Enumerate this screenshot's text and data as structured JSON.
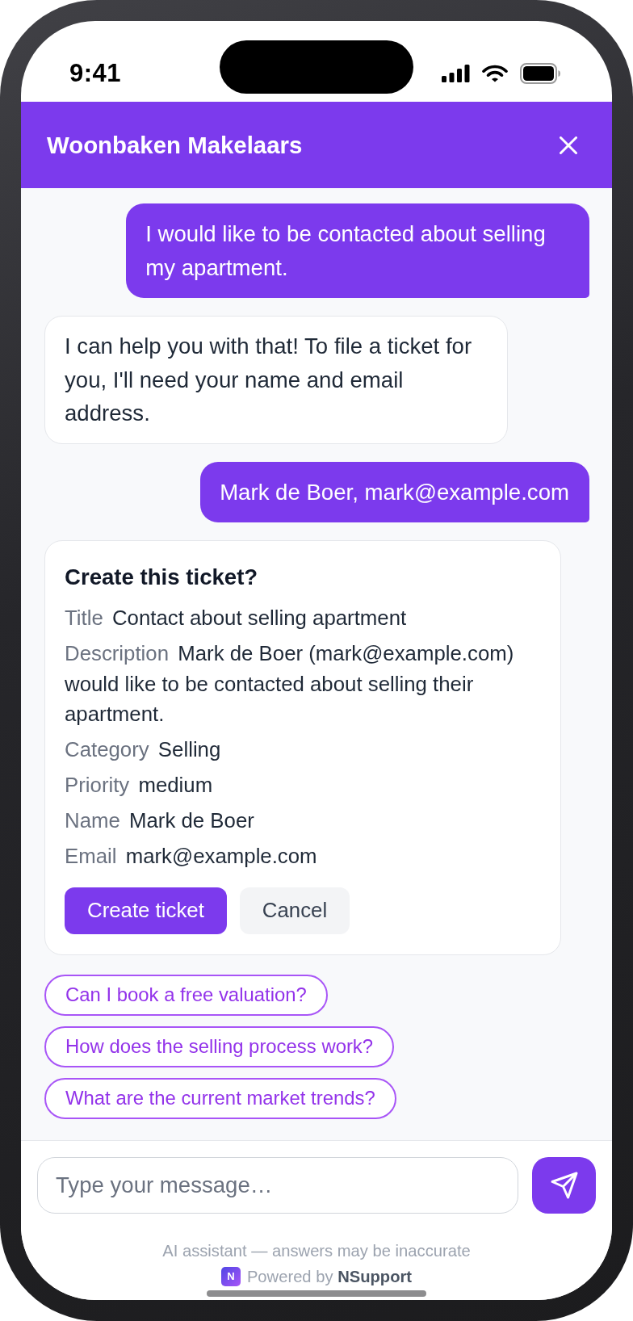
{
  "status_bar": {
    "time": "9:41"
  },
  "header": {
    "title": "Woonbaken Makelaars"
  },
  "messages": [
    {
      "kind": "user",
      "text": "I would like to be contacted about selling my apartment."
    },
    {
      "kind": "bot",
      "text": "I can help you with that! To file a ticket for you, I'll need your name and email address."
    },
    {
      "kind": "user",
      "text": "Mark de Boer, mark@example.com"
    },
    {
      "kind": "ticket",
      "title": "Create this ticket?",
      "fields": [
        {
          "label": "Title",
          "value": "Contact about selling apartment"
        },
        {
          "label": "Description",
          "value": "Mark de Boer (mark@example.com) would like to be contacted about selling their apartment."
        },
        {
          "label": "Category",
          "value": "Selling"
        },
        {
          "label": "Priority",
          "value": "medium"
        },
        {
          "label": "Name",
          "value": "Mark de Boer"
        },
        {
          "label": "Email",
          "value": "mark@example.com"
        }
      ],
      "buttons": [
        {
          "kind": "primary",
          "label": "Create ticket"
        },
        {
          "kind": "secondary",
          "label": "Cancel"
        }
      ]
    }
  ],
  "suggestions": [
    {
      "label": "Can I book a free valuation?"
    },
    {
      "label": "How does the selling process work?"
    },
    {
      "label": "What are the current market trends?"
    }
  ],
  "composer": {
    "placeholder": "Type your message…"
  },
  "footer": {
    "disclaimer": "AI assistant — answers may be inaccurate",
    "logo": "N",
    "powered": "Powered by **NSupport**"
  }
}
